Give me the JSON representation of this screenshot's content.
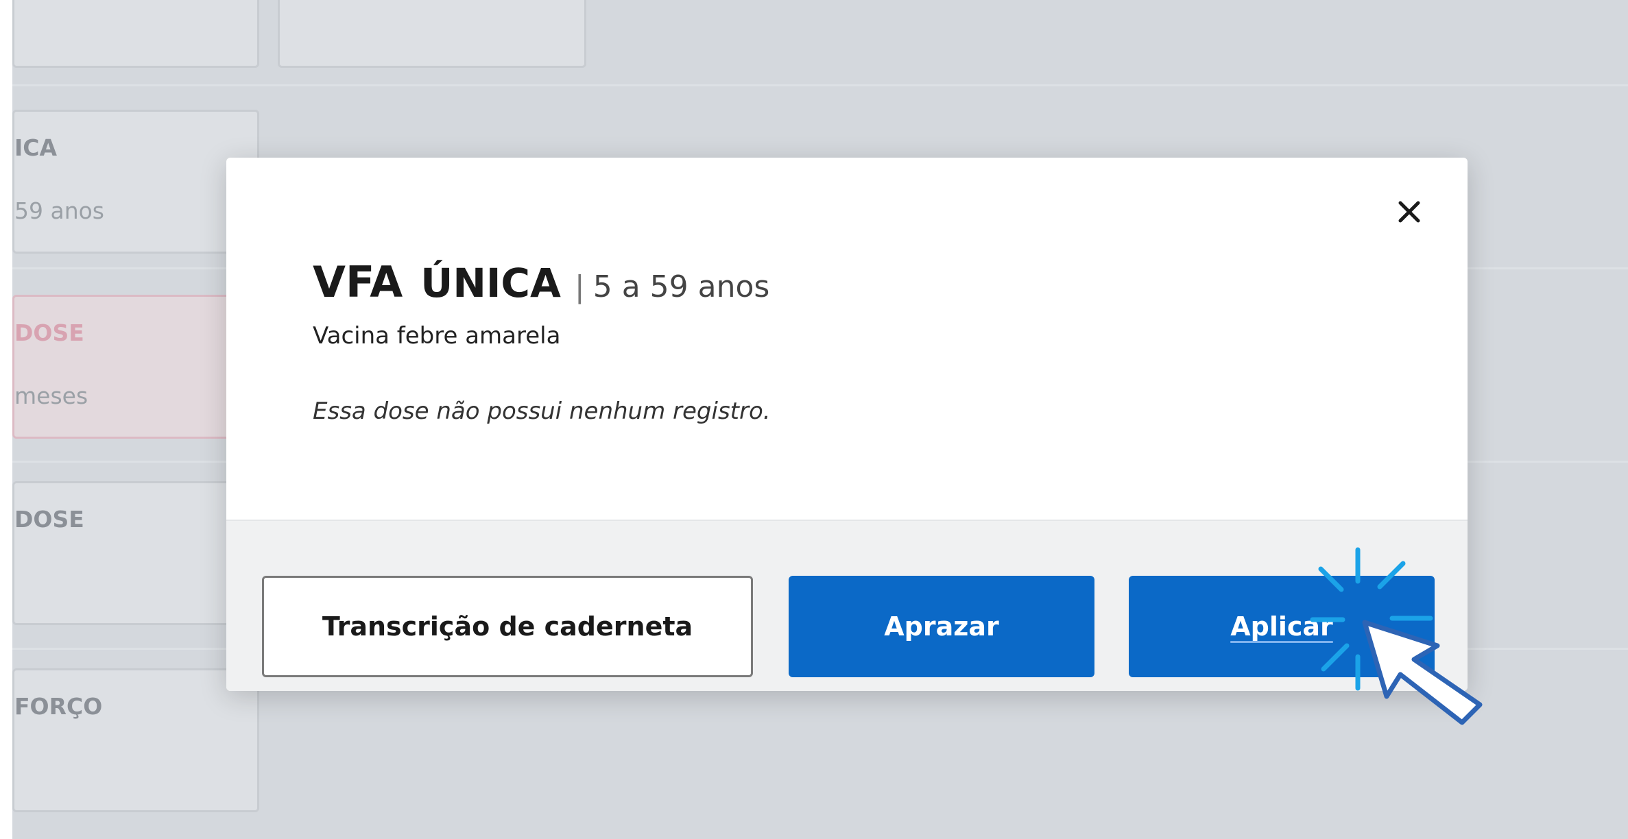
{
  "background": {
    "cards": [
      {
        "title": "",
        "subtitle": ""
      },
      {
        "title": "",
        "subtitle": ""
      },
      {
        "title": "ICA",
        "subtitle": "59 anos"
      },
      {
        "title": "DOSE",
        "subtitle": "meses"
      },
      {
        "title": "DOSE",
        "subtitle": ""
      },
      {
        "title": "FORÇO",
        "subtitle": ""
      }
    ]
  },
  "modal": {
    "code": "VFA",
    "dose_type": "ÚNICA",
    "separator": "|",
    "age_range": "5 a 59 anos",
    "vaccine_name": "Vacina febre amarela",
    "no_record_message": "Essa dose não possui nenhum registro.",
    "close_icon": "close-icon",
    "buttons": {
      "transcription": "Transcrição de caderneta",
      "schedule": "Aprazar",
      "apply": "Aplicar"
    }
  },
  "colors": {
    "primary": "#0b69c7",
    "overlay": "#d4d8dd",
    "pink_card": "#dcbac4",
    "click_effect": "#1ba3e8",
    "cursor_outline": "#2d64b5"
  }
}
